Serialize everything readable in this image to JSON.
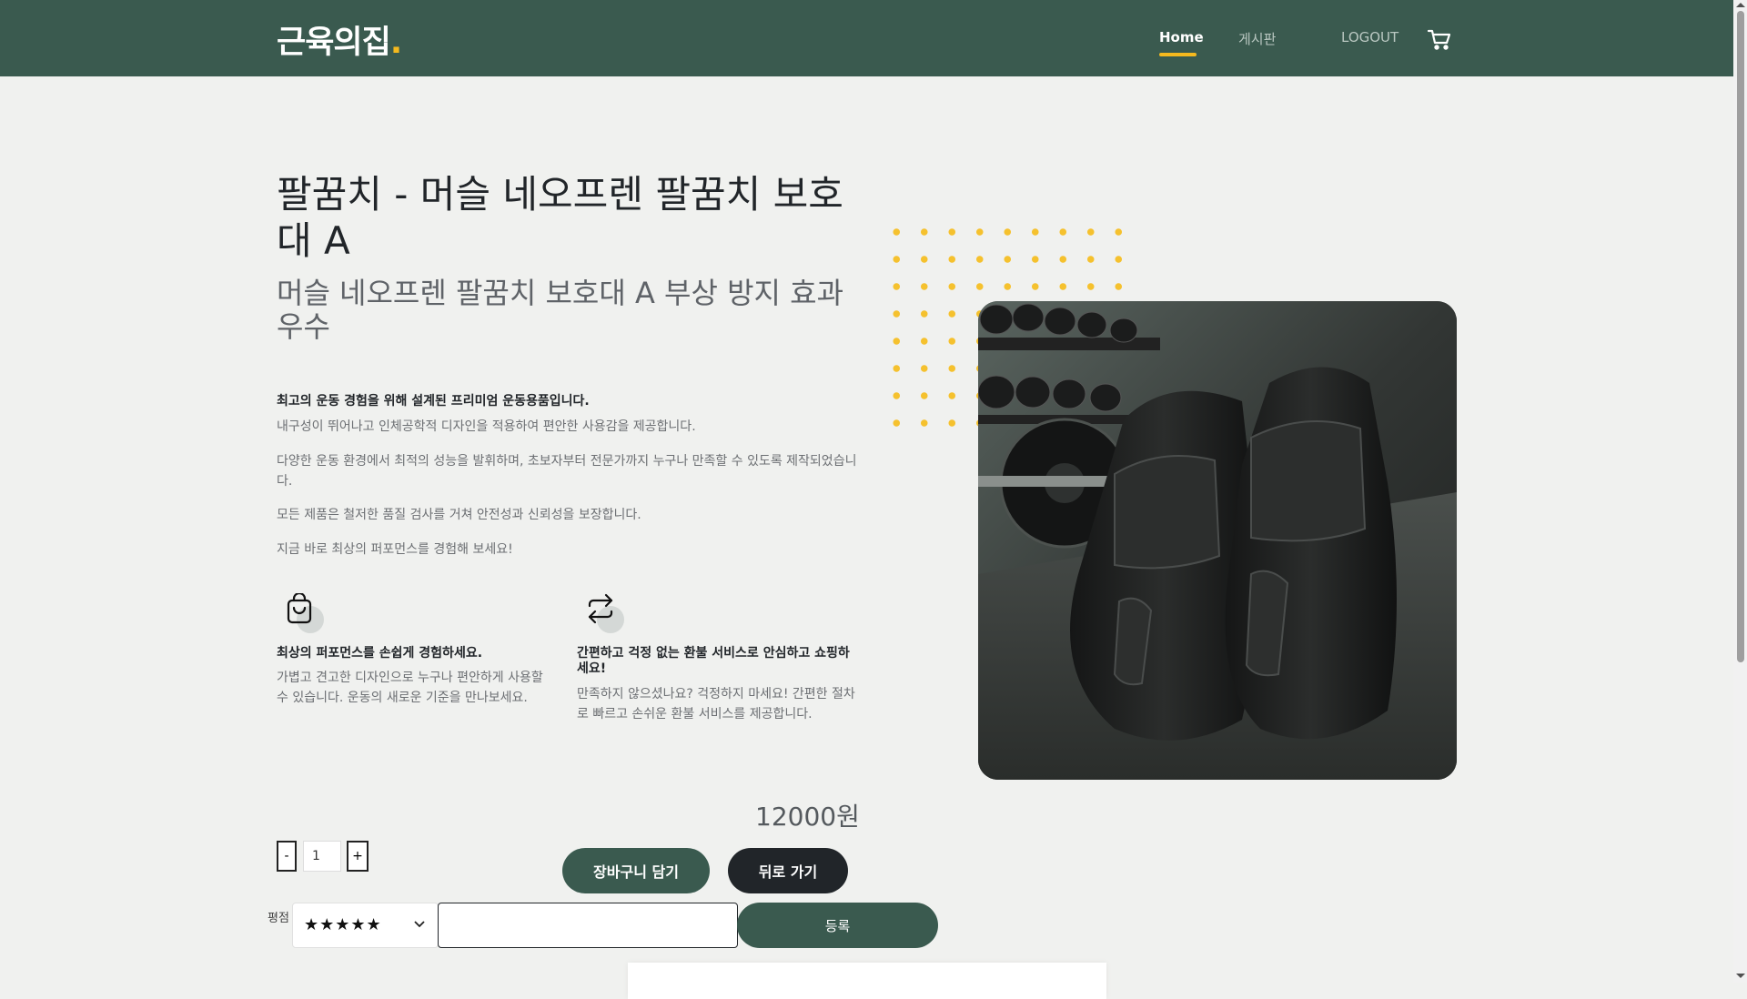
{
  "header": {
    "logo": "근육의집",
    "logo_dot": ".",
    "nav": {
      "home": "Home",
      "board": "게시판",
      "logout": "LOGOUT"
    },
    "cart_icon": "cart-icon"
  },
  "product": {
    "title": "팔꿈치 - 머슬 네오프렌 팔꿈치 보호대 A",
    "subtitle": "머슬 네오프렌 팔꿈치 보호대 A 부상 방지 효과 우수",
    "description_lead": "최고의 운동 경험을 위해 설계된 프리미엄 운동용품입니다.",
    "descriptions": [
      "내구성이 뛰어나고 인체공학적 디자인을 적용하여 편안한 사용감을 제공합니다.",
      "다양한 운동 환경에서 최적의 성능을 발휘하며, 초보자부터 전문가까지 누구나 만족할 수 있도록 제작되었습니다.",
      "모든 제품은 철저한 품질 검사를 거쳐 안전성과 신뢰성을 보장합니다.",
      "지금 바로 최상의 퍼포먼스를 경험해 보세요!"
    ],
    "features": [
      {
        "icon": "shopping-bag-icon",
        "title": "최상의 퍼포먼스를 손쉽게 경험하세요.",
        "text": "가볍고 견고한 디자인으로 누구나 편안하게 사용할 수 있습니다. 운동의 새로운 기준을 만나보세요."
      },
      {
        "icon": "exchange-arrows-icon",
        "title": "간편하고 걱정 없는 환불 서비스로 안심하고 쇼핑하세요!",
        "text": "만족하지 않으셨나요? 걱정하지 마세요! 간편한 절차로 빠르고 손쉬운 환불 서비스를 제공합니다."
      }
    ],
    "price": "12000원",
    "image_icon": "knee-pads-photo"
  },
  "purchase": {
    "minus_label": "-",
    "quantity": "1",
    "plus_label": "+",
    "add_to_cart_label": "장바구니 담기",
    "back_label": "뒤로 가기"
  },
  "review": {
    "rating_label": "평점",
    "rating_value": "★★★★★",
    "input_value": "",
    "submit_label": "등록"
  },
  "colors": {
    "brand": "#3a5a4f",
    "accent": "#f5b91e",
    "dark": "#212529"
  }
}
